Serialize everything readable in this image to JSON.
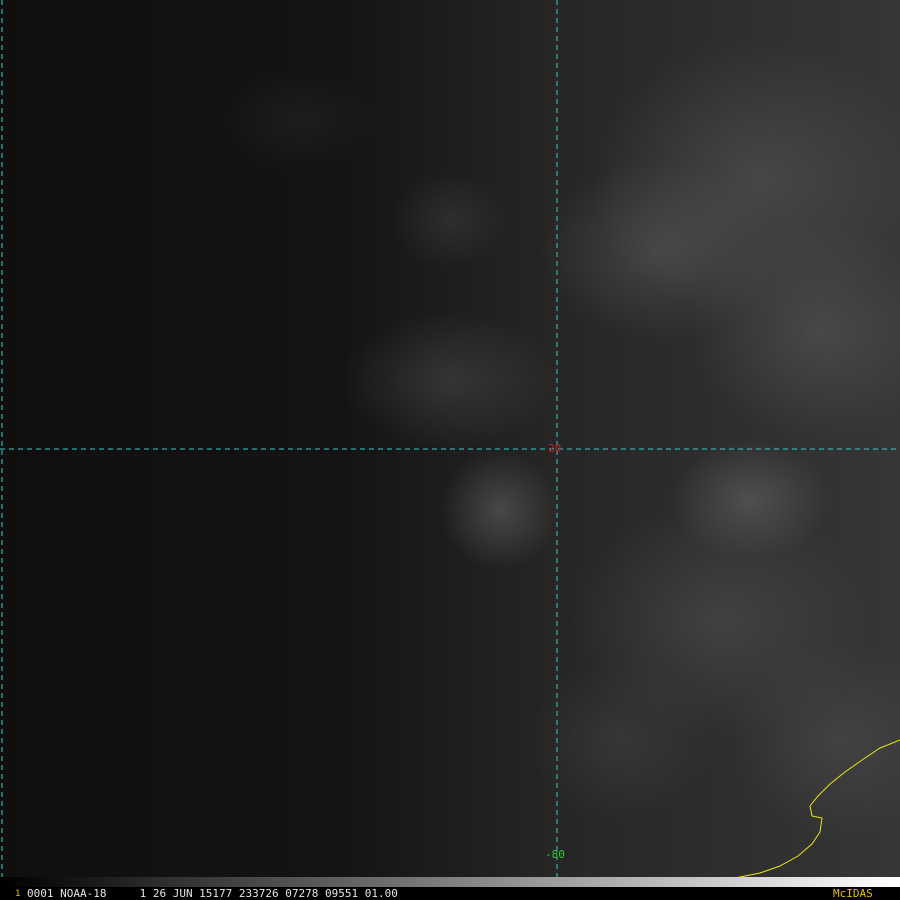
{
  "map": {
    "satellite": "NOAA-18",
    "gridline_color": "#33cccc",
    "coastline_color": "#e6e61a",
    "latitude_label": {
      "text": "20",
      "color": "#cc1a1a"
    },
    "longitude_label": {
      "text": "-80",
      "color": "#2ecc2e"
    }
  },
  "status_bar": {
    "frame_number": "1",
    "frame_number_color": "#e6c200",
    "image_info": "0001 NOAA-18     1 26 JUN 15177 233726 07278 09551 01.00",
    "image_info_color": "#e6e6e6",
    "software_label": "McIDAS",
    "software_label_color": "#e6c200"
  }
}
